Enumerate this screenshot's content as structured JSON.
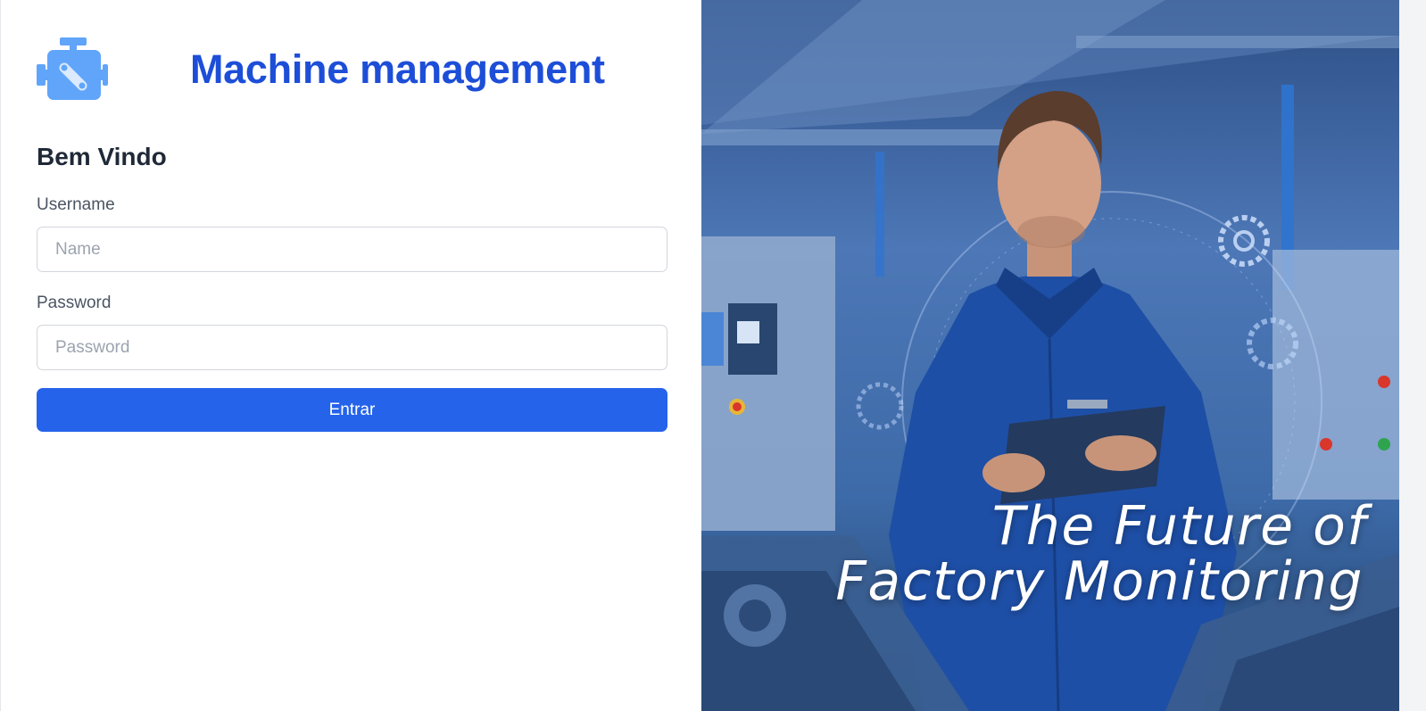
{
  "header": {
    "logo_icon": "engine-icon",
    "title": "Machine management"
  },
  "form": {
    "welcome": "Bem Vindo",
    "username_label": "Username",
    "username_placeholder": "Name",
    "username_value": "",
    "password_label": "Password",
    "password_placeholder": "Password",
    "password_value": "",
    "submit_label": "Entrar"
  },
  "hero": {
    "line1": "The Future of",
    "line2": "Factory Monitoring",
    "image": "factory-worker-with-clipboard"
  },
  "colors": {
    "accent": "#2563eb",
    "title": "#1d4ed8",
    "logo": "#60a5fa"
  }
}
